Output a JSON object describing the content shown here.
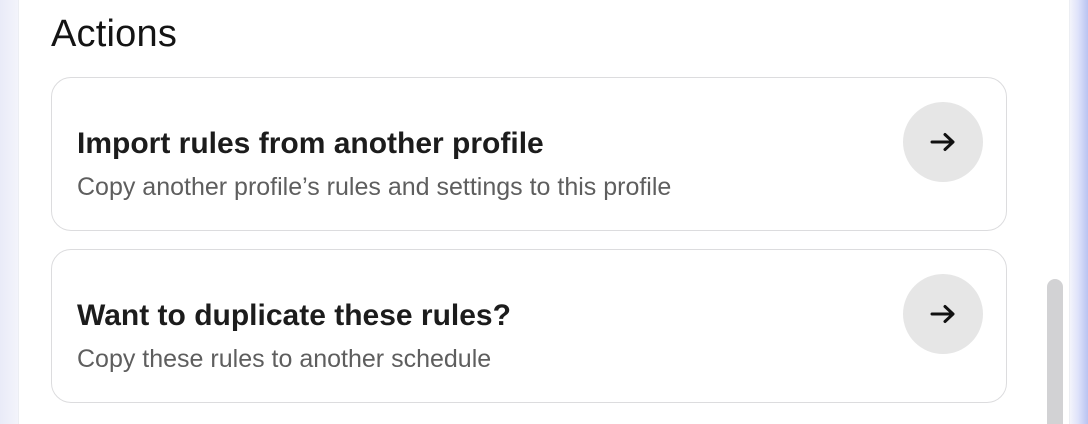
{
  "section": {
    "title": "Actions"
  },
  "actions": [
    {
      "title": "Import rules from another profile",
      "description": "Copy another profile’s rules and settings to this profile",
      "icon": "arrow-right-icon"
    },
    {
      "title": "Want to duplicate these rules?",
      "description": "Copy these rules to another schedule",
      "icon": "arrow-right-icon"
    }
  ],
  "colors": {
    "arrow_button_bg": "#e6e6e6",
    "card_border": "#dcdcde",
    "title_text": "#1c1c1c",
    "description_text": "#5e5e5e"
  }
}
